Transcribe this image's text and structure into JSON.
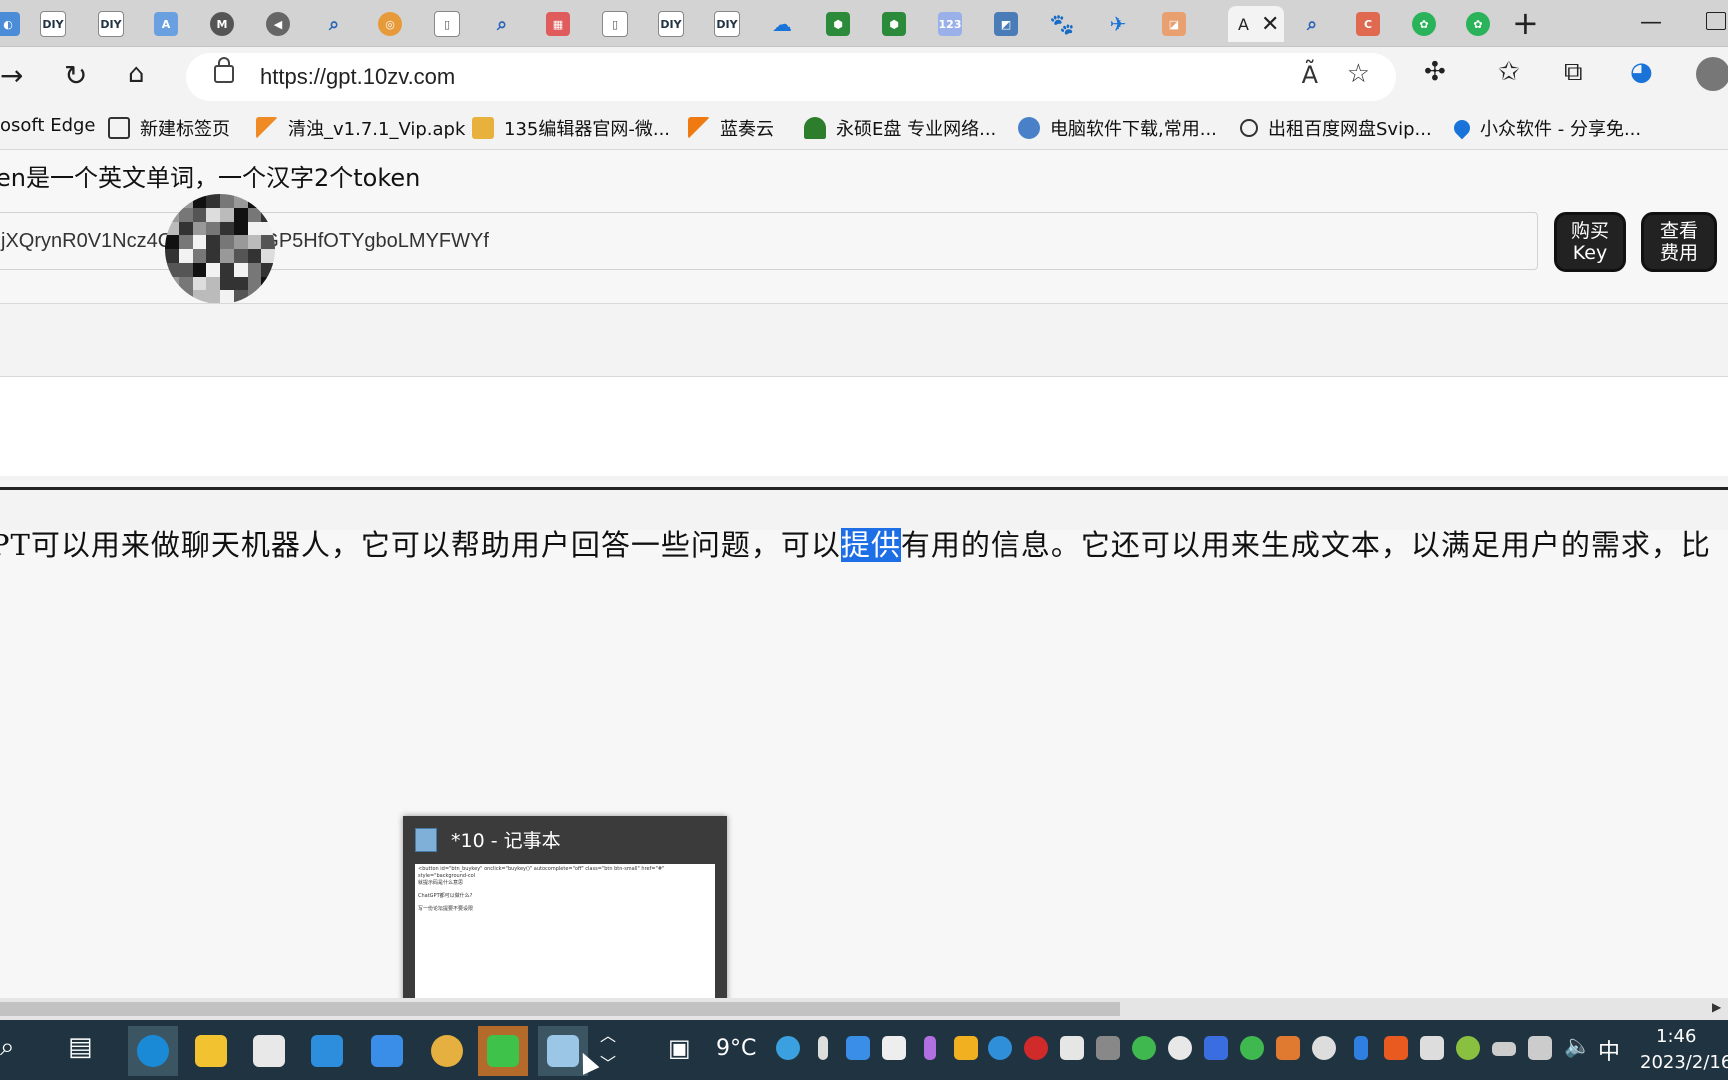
{
  "browser": {
    "url": "https://gpt.10zv.com",
    "active_tab_partial": "A",
    "tab_favicon_texts": [
      "DIY",
      "DIY",
      "DIY",
      "DIY",
      "123"
    ],
    "bookmarks": [
      {
        "label": "osoft Edge",
        "color": "#1c7ad6"
      },
      {
        "label": "新建标签页",
        "color": "#333333"
      },
      {
        "label": "清浊_v1.7.1_Vip.apk",
        "color": "#f08a24"
      },
      {
        "label": "135编辑器官网-微...",
        "color": "#e8b13c"
      },
      {
        "label": "蓝奏云",
        "color": "#f07a12"
      },
      {
        "label": "永硕E盘 专业网络...",
        "color": "#2c7d2c"
      },
      {
        "label": "电脑软件下载,常用...",
        "color": "#4a80c8"
      },
      {
        "label": "出租百度网盘Svip...",
        "color": "#333333"
      },
      {
        "label": "小众软件 - 分享免...",
        "color": "#1a73d9"
      }
    ]
  },
  "page": {
    "intro_text": "en是一个英文单词，一个汉字2个token",
    "api_key_value": "jXQrynR0V1Ncz4Q",
    "api_key_value_tail": "GP5HfOTYgboLMYFWYf",
    "buy_key_label": "购买\nKey",
    "buy_key_line1": "购买",
    "buy_key_line2": "Key",
    "view_cost_line1": "查看",
    "view_cost_line2": "费用",
    "answer_before": "PT可以用来做聊天机器人，它可以帮助用户回答一些问题，可以",
    "answer_highlight": "提供",
    "answer_after": "有用的信息。它还可以用来生成文本，以满足用户的需求，比"
  },
  "notepad_preview": {
    "title": "*10 - 记事本",
    "thumb_lines": [
      "<button id=\"btn_buykey\" onclick=\"buykey()\" autocomplete=\"off\" class=\"btn btn-small\" href=\"#\" style=\"background-col",
      "就提示码是什么意思",
      "ChatGPT都可以做什么?",
      "写一份论坛提要不要设限"
    ]
  },
  "taskbar": {
    "weather": "9°C",
    "ime": "中",
    "time": "1:46",
    "date": "2023/2/16"
  }
}
